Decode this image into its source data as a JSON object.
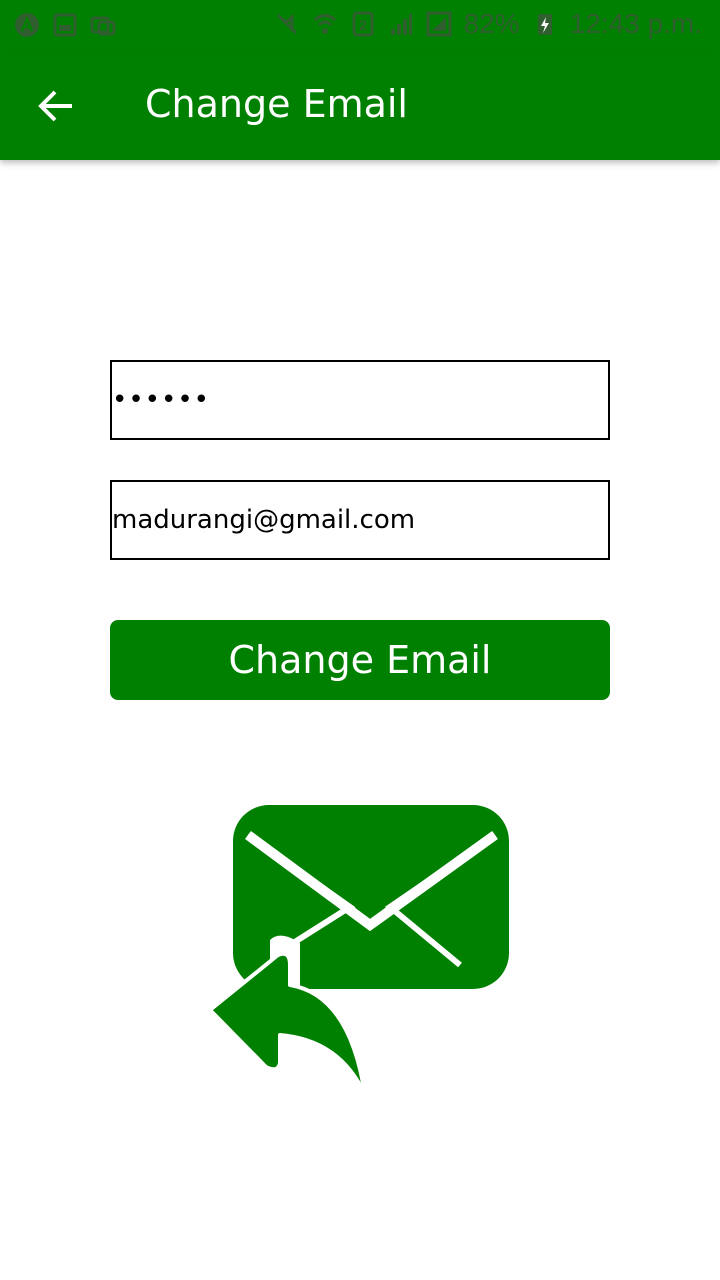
{
  "status_bar": {
    "battery": "82%",
    "time": "12:43 p.m."
  },
  "app_bar": {
    "title": "Change Email"
  },
  "form": {
    "password_value": "••••••",
    "email_value": "madurangi@gmail.com",
    "submit_label": "Change Email"
  },
  "colors": {
    "primary": "#008000",
    "background": "#ffffff"
  },
  "icons": {
    "back": "arrow-back-icon",
    "illustration": "email-reply-icon"
  }
}
